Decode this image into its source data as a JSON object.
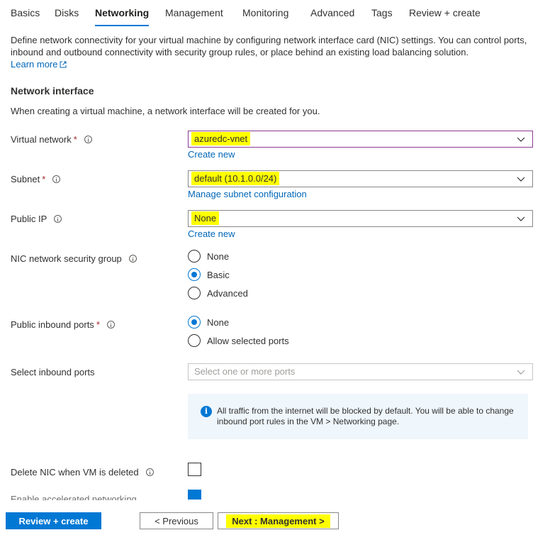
{
  "tabs": [
    {
      "label": "Basics"
    },
    {
      "label": "Disks"
    },
    {
      "label": "Networking",
      "active": true
    },
    {
      "label": "Management"
    },
    {
      "label": "Monitoring"
    },
    {
      "label": "Advanced"
    },
    {
      "label": "Tags"
    },
    {
      "label": "Review + create"
    }
  ],
  "intro": {
    "text": "Define network connectivity for your virtual machine by configuring network interface card (NIC) settings. You can control ports, inbound and outbound connectivity with security group rules, or place behind an existing load balancing solution.",
    "learn_more": "Learn more"
  },
  "network_interface": {
    "title": "Network interface",
    "description": "When creating a virtual machine, a network interface will be created for you."
  },
  "fields": {
    "virtual_network": {
      "label": "Virtual network",
      "required": "*",
      "value": "azuredc-vnet",
      "link": "Create new"
    },
    "subnet": {
      "label": "Subnet",
      "required": "*",
      "value": "default (10.1.0.0/24)",
      "link": "Manage subnet configuration"
    },
    "public_ip": {
      "label": "Public IP",
      "value": "None",
      "link": "Create new"
    },
    "nic_nsg": {
      "label": "NIC network security group",
      "options": [
        "None",
        "Basic",
        "Advanced"
      ],
      "selected": "Basic"
    },
    "public_inbound_ports": {
      "label": "Public inbound ports",
      "required": "*",
      "options": [
        "None",
        "Allow selected ports"
      ],
      "selected": "None"
    },
    "select_inbound_ports": {
      "label": "Select inbound ports",
      "placeholder": "Select one or more ports"
    },
    "inbound_info": "All traffic from the internet will be blocked by default. You will be able to change inbound port rules in the VM > Networking page.",
    "delete_nic": {
      "label": "Delete NIC when VM is deleted",
      "checked": false
    },
    "accelerated_networking": {
      "label": "Enable accelerated networking",
      "checked": true
    }
  },
  "footer": {
    "review_create": "Review + create",
    "previous": "< Previous",
    "next": "Next : Management >"
  },
  "colors": {
    "accent": "#0078d4",
    "highlight": "#ffff00",
    "link": "#0067b8"
  }
}
